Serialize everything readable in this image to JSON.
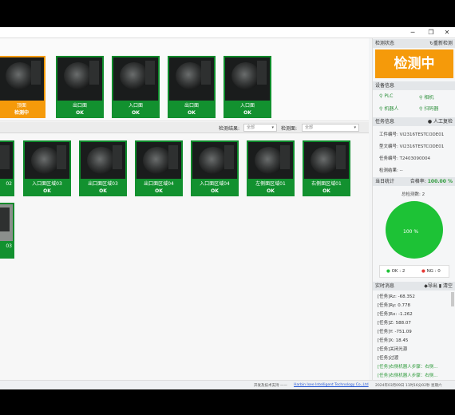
{
  "window": {
    "controls": [
      "─",
      "❐",
      "✕"
    ]
  },
  "top_cards": [
    {
      "name": "顶面",
      "status": "检测中",
      "active": true
    },
    {
      "name": "出口面",
      "status": "OK"
    },
    {
      "name": "入口面",
      "status": "OK"
    },
    {
      "name": "出口面",
      "status": "OK"
    },
    {
      "name": "入口面",
      "status": "OK"
    }
  ],
  "filter": {
    "result_label": "检测结果:",
    "result_value": "全部",
    "surface_label": "检测面:",
    "surface_value": "全部"
  },
  "grid_cards": [
    {
      "name": "02",
      "status": "OK"
    },
    {
      "name": "入口面区域03",
      "status": "OK"
    },
    {
      "name": "出口面区域03",
      "status": "OK"
    },
    {
      "name": "出口面区域04",
      "status": "OK"
    },
    {
      "name": "入口面区域04",
      "status": "OK"
    },
    {
      "name": "左侧面区域01",
      "status": "OK"
    },
    {
      "name": "右侧面区域01",
      "status": "OK"
    },
    {
      "name": "03",
      "status": ""
    }
  ],
  "side": {
    "detect_status_title": "检测状态",
    "restart_label": "重新检测",
    "status_big": "检测中",
    "device_title": "设备信息",
    "devices": [
      "PLC",
      "相机",
      "机器人",
      "扫码器"
    ],
    "task_title": "任务信息",
    "manual_review": "人工复检",
    "task_fields": [
      {
        "k": "工件编号:",
        "v": "VI2316TESTCODE01"
      },
      {
        "k": "型文编号:",
        "v": "VI2316TESTCODE01"
      },
      {
        "k": "任务编号:",
        "v": "T2403090004"
      },
      {
        "k": "检测结果:",
        "v": "--"
      }
    ],
    "stats_title": "当日统计",
    "pass_rate_label": "合格率:",
    "pass_rate_value": "100.00 %",
    "total_label": "总检测数:",
    "total_value": "2",
    "ok_label": "OK : 2",
    "ng_label": "NG : 0",
    "msg_title": "实时消息",
    "export_label": "导出",
    "clear_label": "清空",
    "messages": [
      "[任务]Rz: -68.352",
      "[任务]Ry: 0.778",
      "[任务]Rx: -1.262",
      "[任务]Z: 588.07",
      "[任务]Y: -751.09",
      "[任务]X: 18.45",
      "[任务]关闭光源",
      "[任务]过渡",
      "[任务]右侧机器人步骤：右侧...",
      "[任务]右侧机器人步骤：右侧..."
    ]
  },
  "chart_data": {
    "type": "pie",
    "categories": [
      "OK",
      "NG"
    ],
    "values": [
      2,
      0
    ],
    "slice_label": "100 %",
    "colors": [
      "#1dc236",
      "#e53935"
    ]
  },
  "status_bar": {
    "support_text": "开发及技术支持 ——",
    "company": "Harbin Isee Intelligent Technology Co.,Ltd",
    "datetime": "2024年03月09日 11时16分02秒 星期六"
  }
}
